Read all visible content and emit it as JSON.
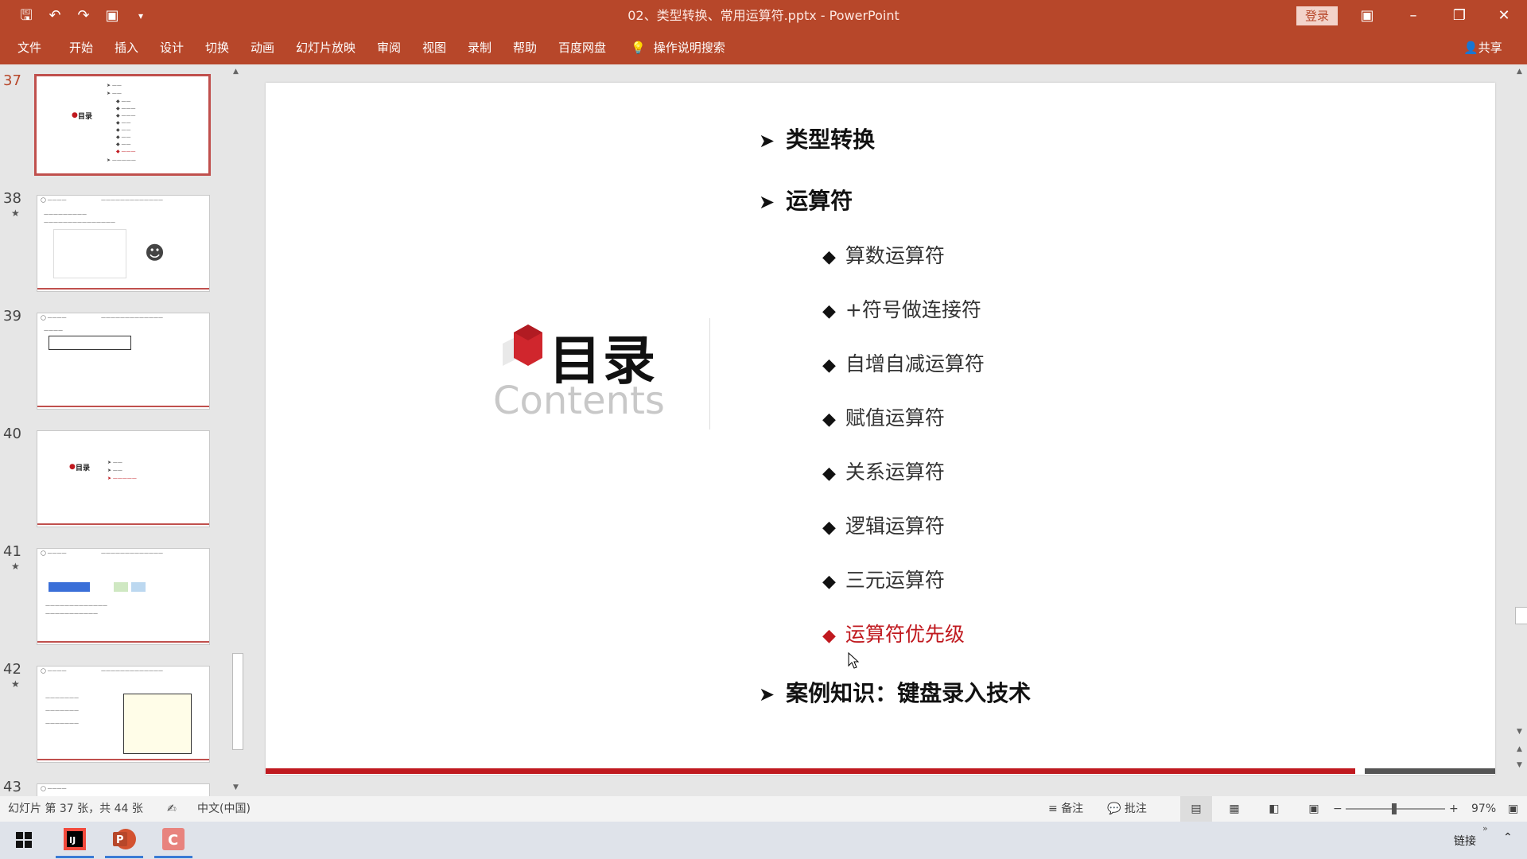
{
  "window": {
    "title": "02、类型转换、常用运算符.pptx  -  PowerPoint",
    "login_label": "登录"
  },
  "ribbon": {
    "tabs": [
      "文件",
      "开始",
      "插入",
      "设计",
      "切换",
      "动画",
      "幻灯片放映",
      "审阅",
      "视图",
      "录制",
      "帮助",
      "百度网盘"
    ],
    "search_label": "操作说明搜索",
    "share_label": "共享"
  },
  "thumbnails": [
    {
      "number": "37",
      "starred": false,
      "active": true
    },
    {
      "number": "38",
      "starred": true,
      "active": false
    },
    {
      "number": "39",
      "starred": false,
      "active": false
    },
    {
      "number": "40",
      "starred": false,
      "active": false
    },
    {
      "number": "41",
      "starred": true,
      "active": false
    },
    {
      "number": "42",
      "starred": true,
      "active": false
    },
    {
      "number": "43",
      "starred": false,
      "active": false
    }
  ],
  "slide": {
    "heading": "目录",
    "subheading": "Contents",
    "items": [
      {
        "text": "类型转换",
        "level": 1
      },
      {
        "text": "运算符",
        "level": 1
      },
      {
        "text": "算数运算符",
        "level": 2
      },
      {
        "text": "+符号做连接符",
        "level": 2
      },
      {
        "text": "自增自减运算符",
        "level": 2
      },
      {
        "text": "赋值运算符",
        "level": 2
      },
      {
        "text": "关系运算符",
        "level": 2
      },
      {
        "text": "逻辑运算符",
        "level": 2
      },
      {
        "text": "三元运算符",
        "level": 2
      },
      {
        "text": "运算符优先级",
        "level": 2,
        "highlight": true
      },
      {
        "text": "案例知识：键盘录入技术",
        "level": 1
      }
    ]
  },
  "statusbar": {
    "slide_info": "幻灯片 第 37 张，共 44 张",
    "language": "中文(中国)",
    "notes_label": "备注",
    "comments_label": "批注",
    "zoom": "97%"
  },
  "taskbar": {
    "right_label": "链接"
  },
  "colors": {
    "accent": "#b7472a",
    "highlight": "#c0191f"
  }
}
